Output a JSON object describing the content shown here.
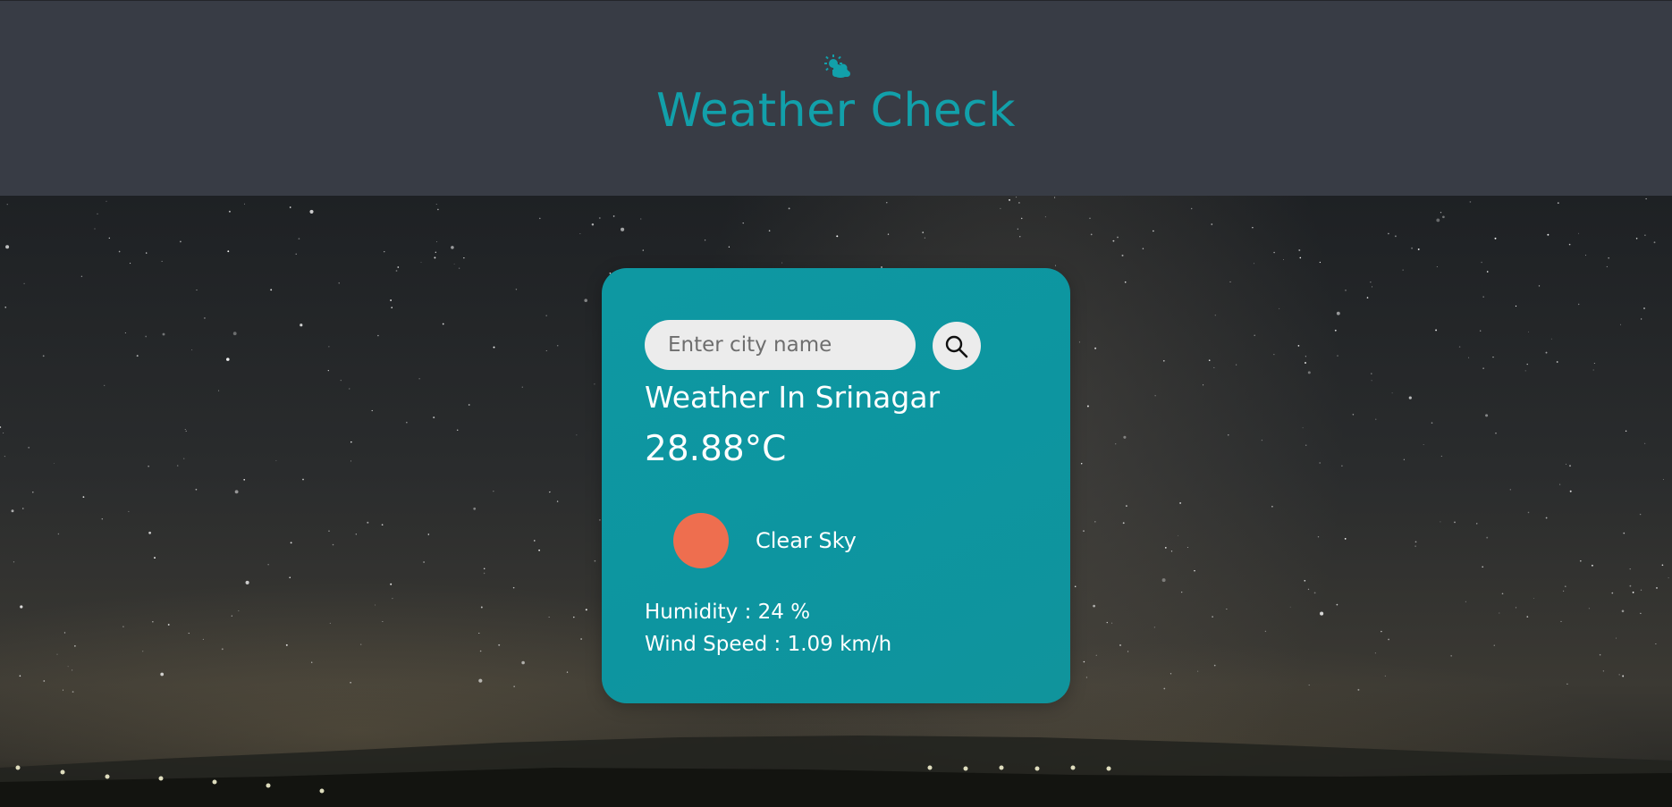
{
  "header": {
    "title": "Weather Check",
    "logo_icon": "sun-behind-cloud-icon",
    "title_color": "#12a0aa",
    "background_color": "#383c45"
  },
  "search": {
    "placeholder": "Enter city name",
    "value": "",
    "button_icon": "search-icon"
  },
  "weather": {
    "city_label": "Weather In Srinagar",
    "temperature": "28.88°C",
    "description": "Clear Sky",
    "icon": "clear-sky-sun-icon",
    "icon_color": "#ee6e4f",
    "humidity": "Humidity : 24 %",
    "wind_speed": "Wind Speed : 1.09 km/h"
  },
  "card": {
    "background_color": "#0e98a2"
  }
}
